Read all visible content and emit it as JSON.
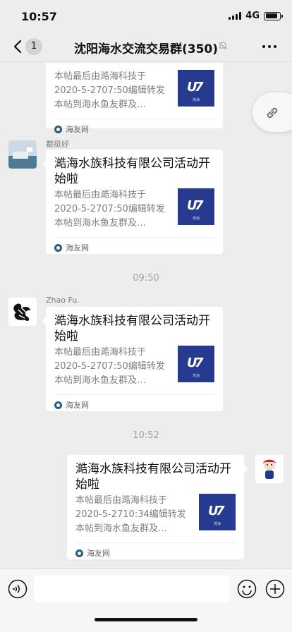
{
  "status_bar": {
    "time": "10:57",
    "network": "4G",
    "battery_level": 0.85
  },
  "nav": {
    "badge": "1",
    "title": "沈阳海水交流交易群(350)"
  },
  "chat": {
    "messages": [
      {
        "sender": "",
        "title": "",
        "desc": "本帖最后由澔海科技于2020-5-2707:50编辑转发本帖到海水鱼友群及…",
        "source": "海友网"
      },
      {
        "sender": "都挺好",
        "title": "澔海水族科技有限公司活动开始啦",
        "desc": "本帖最后由澔海科技于2020-5-2707:50编辑转发本帖到海水鱼友群及…",
        "source": "海友网"
      },
      {
        "sender": "Zhao Fu.",
        "title": "澔海水族科技有限公司活动开始啦",
        "desc": "本帖最后由澔海科技于2020-5-2707:50编辑转发本帖到海水鱼友群及…",
        "source": "海友网"
      },
      {
        "sender": "",
        "title": "澔海水族科技有限公司活动开始啦",
        "desc": "本帖最后由澔海科技于2020-5-2710:34编辑转发本帖到海水鱼友群及…",
        "source": "海友网"
      }
    ],
    "timestamps": [
      "09:50",
      "10:52"
    ],
    "thumb_caption": "澔海"
  },
  "input": {
    "placeholder": ""
  },
  "colors": {
    "background": "#ededed",
    "thumb": "#263a8f",
    "card": "#ffffff"
  }
}
